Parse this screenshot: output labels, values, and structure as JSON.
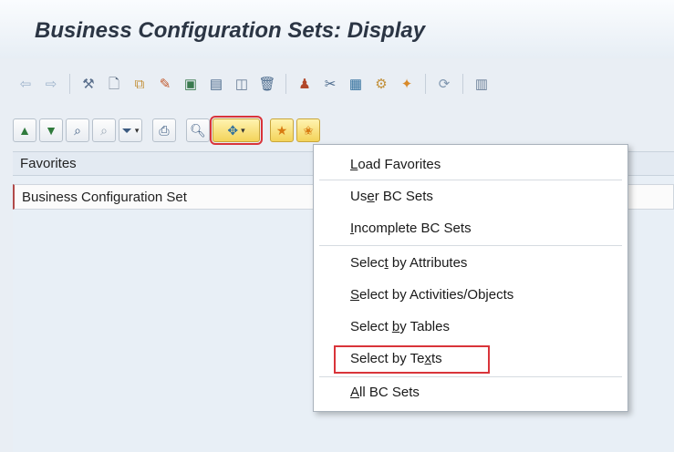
{
  "window": {
    "title": "Business Configuration Sets: Display"
  },
  "toolbar": {
    "icons": [
      "back-arrow-icon",
      "forward-arrow-icon",
      "other-object-icon",
      "create-icon",
      "copy-icon",
      "change-icon",
      "display-icon",
      "save-as-icon",
      "print-preview-icon",
      "delete-icon",
      "where-used-icon",
      "cut-icon",
      "transport-icon",
      "compare-icon",
      "activate-icon",
      "refresh-icon",
      "info-icon"
    ]
  },
  "app_toolbar": {
    "buttons": [
      "sort-ascending-icon",
      "sort-descending-icon",
      "find-icon",
      "find-next-icon",
      "filter-icon",
      "print-icon",
      "search-icon",
      "select-dropdown-icon",
      "add-favorite-icon",
      "favorites-icon"
    ]
  },
  "favorites": {
    "header": "Favorites",
    "row": "Business Configuration Set"
  },
  "menu": {
    "items": [
      {
        "pre": "",
        "u": "L",
        "post": "oad Favorites"
      },
      {
        "pre": "Us",
        "u": "e",
        "post": "r BC Sets"
      },
      {
        "pre": "",
        "u": "I",
        "post": "ncomplete BC Sets"
      },
      {
        "pre": "Selec",
        "u": "t",
        "post": " by Attributes"
      },
      {
        "pre": "",
        "u": "S",
        "post": "elect by Activities/Objects"
      },
      {
        "pre": "Select ",
        "u": "b",
        "post": "y Tables"
      },
      {
        "pre": "Select by Te",
        "u": "x",
        "post": "ts"
      },
      {
        "pre": "",
        "u": "A",
        "post": "ll BC Sets"
      }
    ]
  }
}
